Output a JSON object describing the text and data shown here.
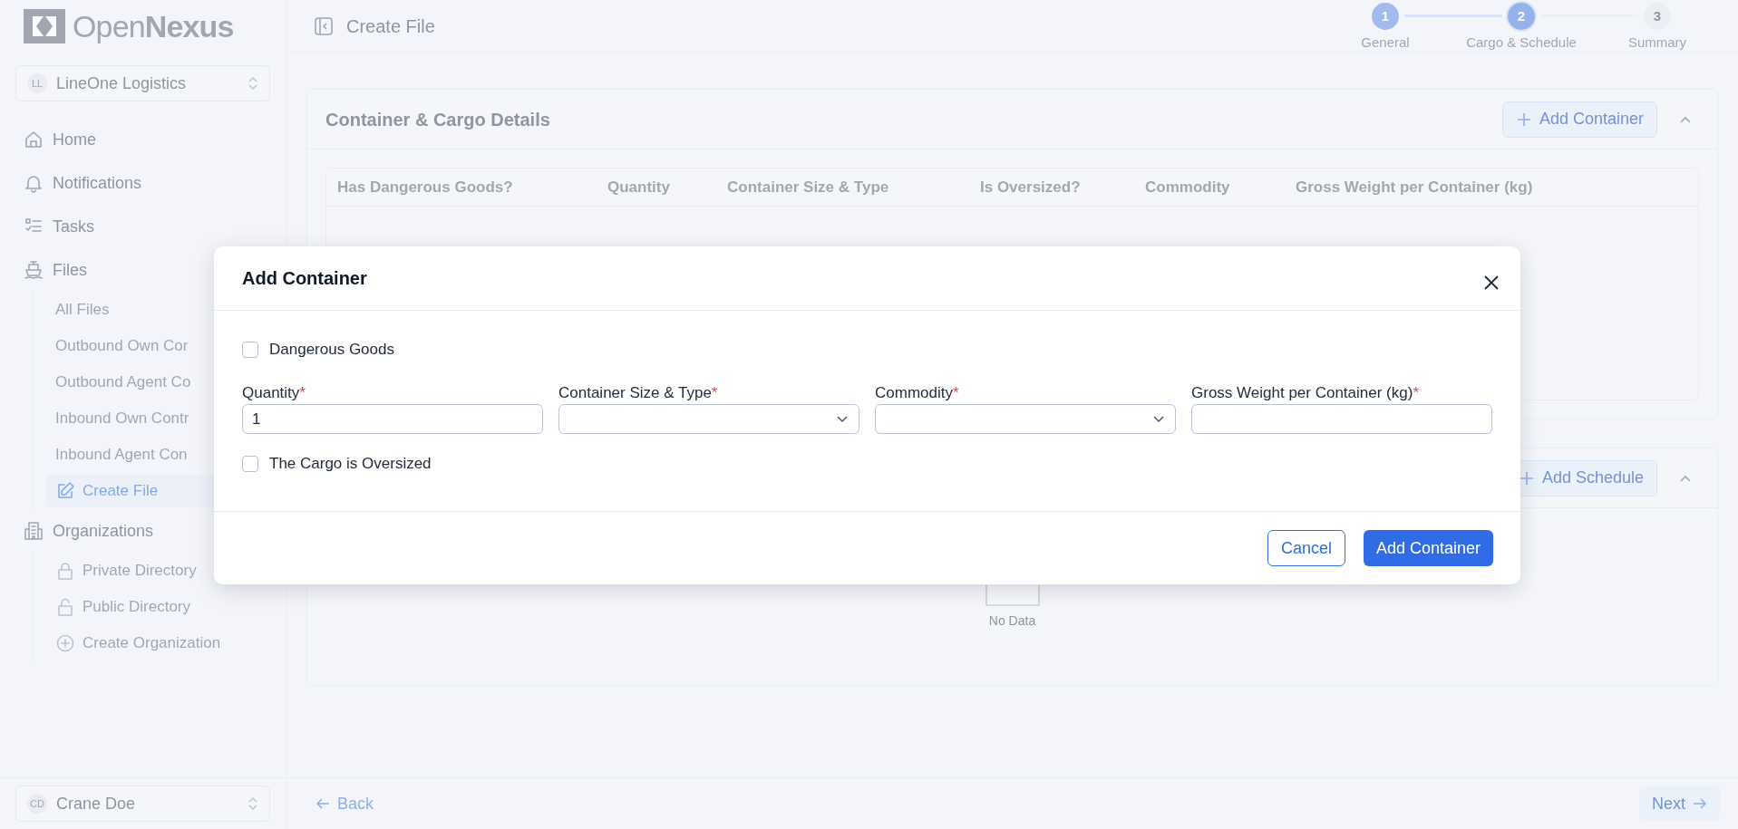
{
  "logo": {
    "light": "Open",
    "bold": "Nexus"
  },
  "org_switcher": {
    "initials": "LL",
    "name": "LineOne Logistics"
  },
  "nav": [
    {
      "label": "Home",
      "selected": false
    },
    {
      "label": "Notifications",
      "selected": false
    },
    {
      "label": "Tasks",
      "selected": false
    },
    {
      "label": "Files",
      "selected": false,
      "children": [
        {
          "label": "All Files",
          "selected": false
        },
        {
          "label": "Outbound Own Cor",
          "selected": false
        },
        {
          "label": "Outbound Agent Co",
          "selected": false
        },
        {
          "label": "Inbound Own Contr",
          "selected": false
        },
        {
          "label": "Inbound Agent Con",
          "selected": false
        },
        {
          "label": "Create File",
          "selected": true
        }
      ]
    },
    {
      "label": "Organizations",
      "selected": false,
      "children": [
        {
          "label": "Private Directory",
          "selected": false
        },
        {
          "label": "Public Directory",
          "selected": false
        },
        {
          "label": "Create Organization",
          "selected": false
        }
      ]
    }
  ],
  "user": {
    "initials": "CD",
    "name": "Crane Doe"
  },
  "header": {
    "title": "Create File"
  },
  "stepper": [
    {
      "number": "1",
      "label": "General",
      "selected": false
    },
    {
      "number": "2",
      "label": "Cargo & Schedule",
      "selected": true
    },
    {
      "number": "3",
      "label": "Summary",
      "selected": false
    }
  ],
  "container_card": {
    "title": "Container & Cargo Details",
    "add_button": "Add Container",
    "columns": [
      "Has Dangerous Goods?",
      "Quantity",
      "Container Size & Type",
      "Is Oversized?",
      "Commodity",
      "Gross Weight per Container (kg)"
    ]
  },
  "schedule_card": {
    "add_button": "Add Schedule",
    "empty_text": "No Data"
  },
  "footer": {
    "back": "Back",
    "next": "Next"
  },
  "dialog": {
    "title": "Add Container",
    "dangerous_goods": {
      "label": "Dangerous Goods",
      "checked": false
    },
    "inputs": [
      {
        "kind": "text",
        "label": "Quantity",
        "required_mark": "*",
        "value": "1"
      },
      {
        "kind": "select",
        "label": "Container Size & Type",
        "required_mark": "*"
      },
      {
        "kind": "select",
        "label": "Commodity",
        "required_mark": "*"
      },
      {
        "kind": "text",
        "label": "Gross Weight per Container (kg)",
        "required_mark": "*"
      }
    ],
    "oversized": {
      "label": "The Cargo is Oversized",
      "checked": false
    },
    "cancel": "Cancel",
    "confirm": "Add Container"
  }
}
